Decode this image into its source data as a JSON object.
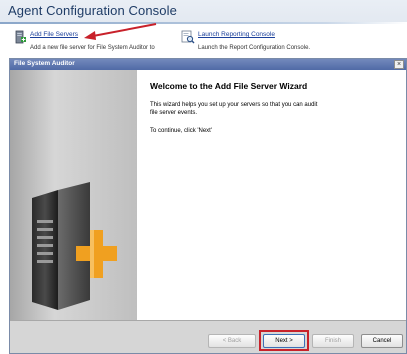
{
  "console": {
    "title": "Agent Configuration Console",
    "actions": [
      {
        "label": "Add File Servers",
        "description": "Add a new file server for File System Auditor to",
        "icon": "server-add-icon"
      },
      {
        "label": "Launch Reporting Console",
        "description": "Launch the Report Configuration Console.",
        "icon": "report-magnifier-icon"
      }
    ]
  },
  "wizard": {
    "title": "File System Auditor",
    "close_glyph": "×",
    "heading": "Welcome to the Add File Server Wizard",
    "paragraph1": "This wizard helps you set up your servers so that you can audit file server events.",
    "paragraph2": "To continue, click 'Next'",
    "buttons": {
      "back": "< Back",
      "next": "Next >",
      "finish": "Finish",
      "cancel": "Cancel"
    }
  },
  "colors": {
    "accent_arrow": "#c8212a",
    "title_bar": "#5f78b0",
    "plus_orange": "#f0a020"
  }
}
